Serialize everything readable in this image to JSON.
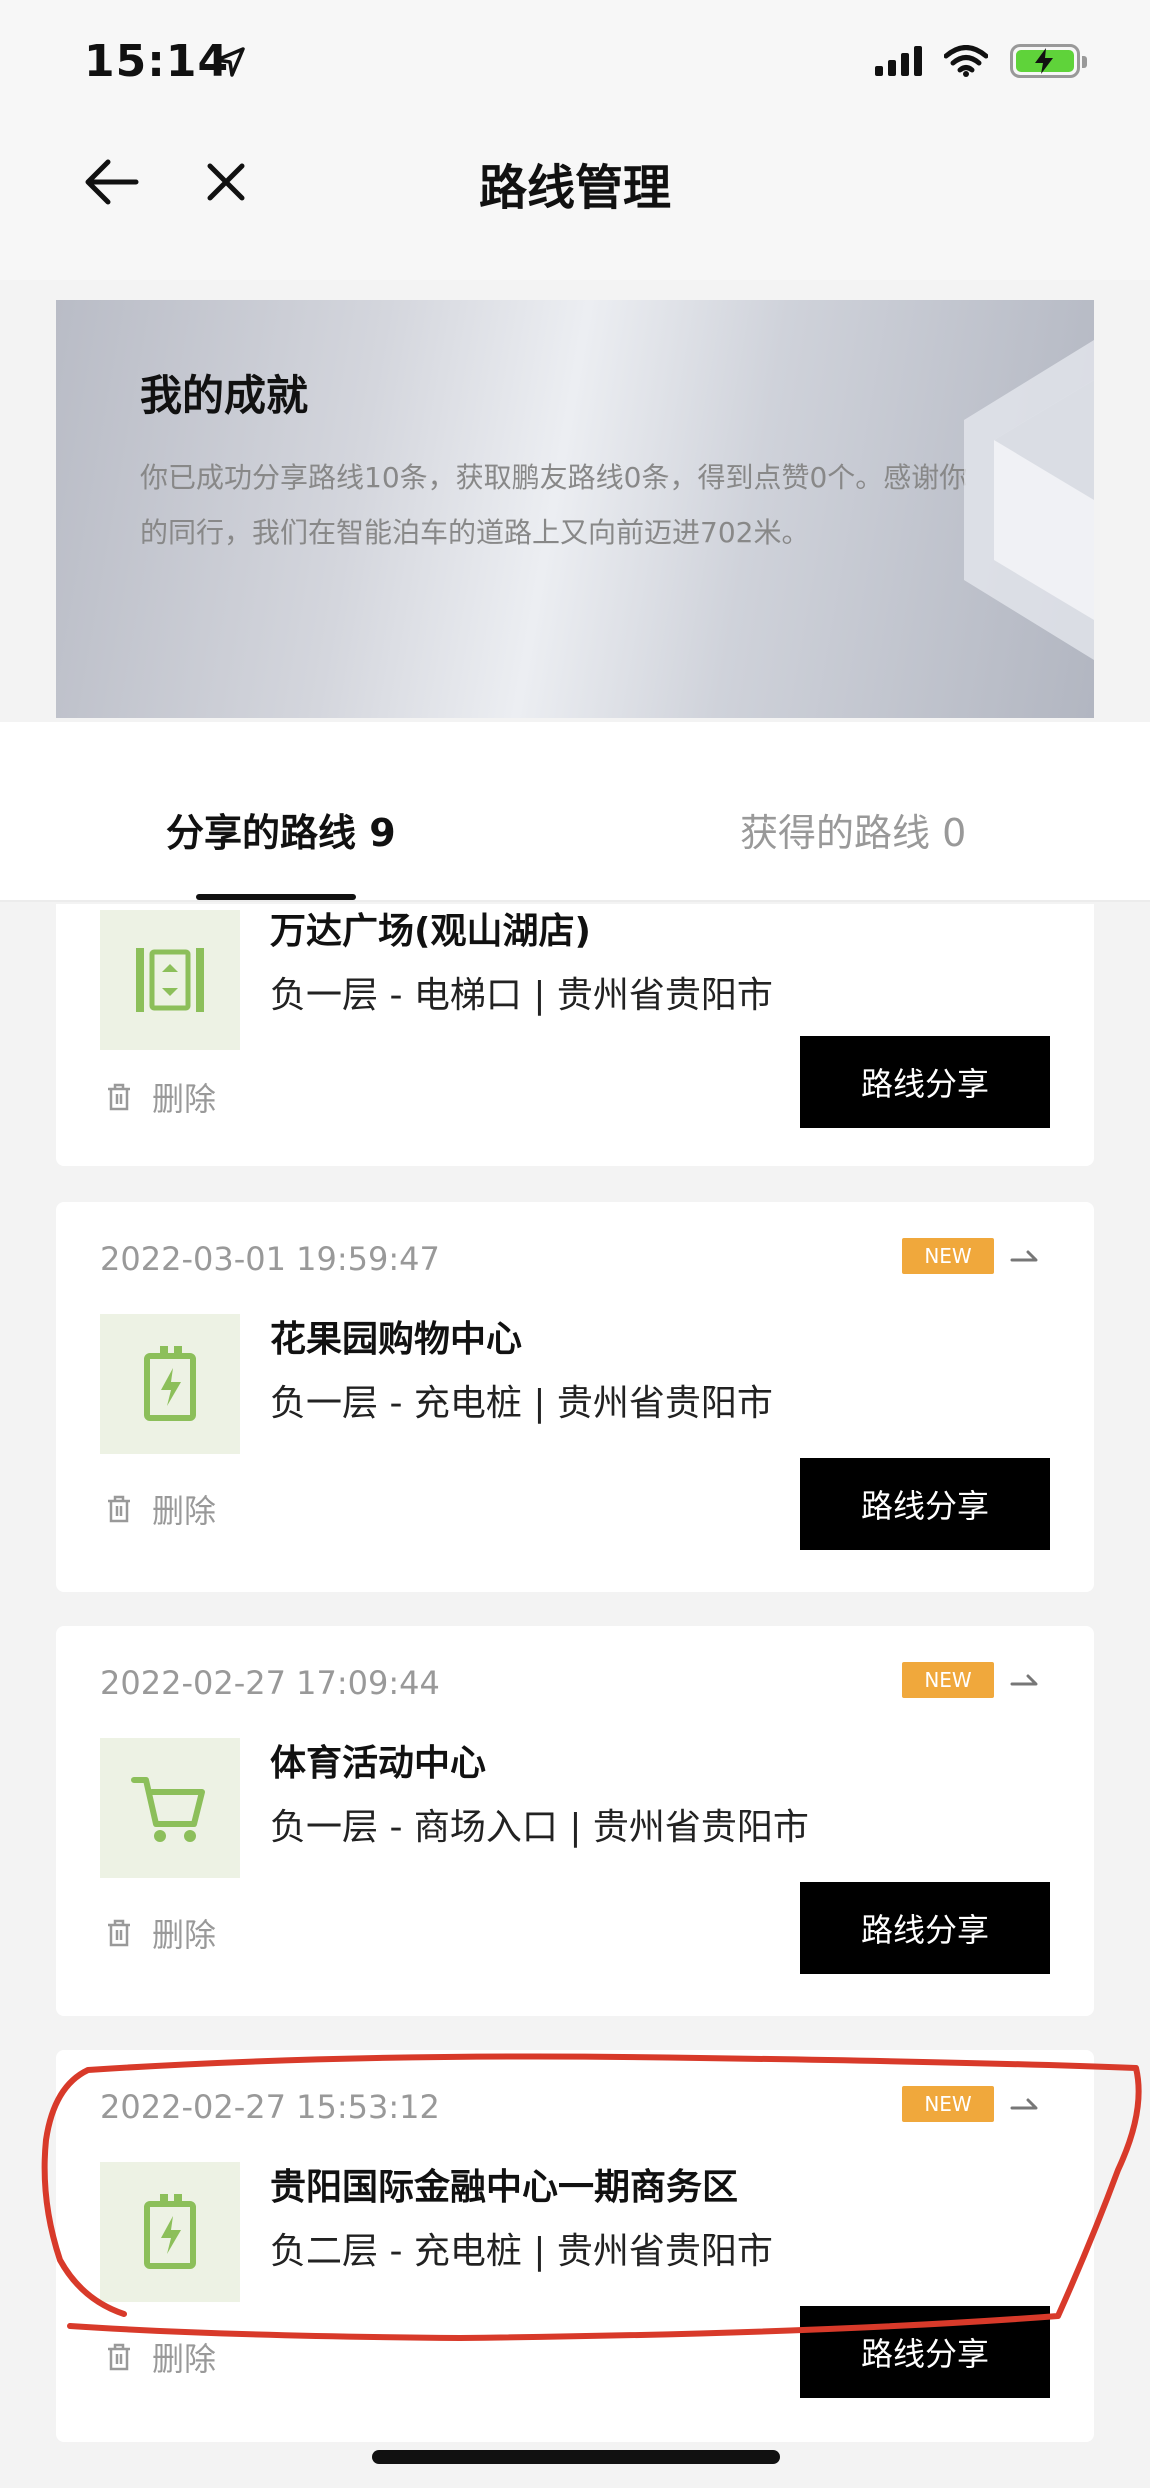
{
  "status_bar": {
    "time": "15:14"
  },
  "nav": {
    "title": "路线管理"
  },
  "achievement": {
    "title": "我的成就",
    "text": "你已成功分享路线10条，获取鹏友路线0条，得到点赞0个。感谢你的同行，我们在智能泊车的道路上又向前迈进702米。"
  },
  "tabs": [
    {
      "label": "分享的路线 9",
      "active": true
    },
    {
      "label": "获得的路线 0",
      "active": false
    }
  ],
  "common": {
    "delete_label": "删除",
    "share_label": "路线分享",
    "new_badge": "NEW"
  },
  "routes": [
    {
      "date": "",
      "name": "万达广场(观山湖店)",
      "detail": "负一层 - 电梯口 | 贵州省贵阳市",
      "icon": "elevator-icon",
      "is_new": false
    },
    {
      "date": "2022-03-01 19:59:47",
      "name": "花果园购物中心",
      "detail": "负一层 - 充电桩 | 贵州省贵阳市",
      "icon": "charging-pile-icon",
      "is_new": true
    },
    {
      "date": "2022-02-27 17:09:44",
      "name": "体育活动中心",
      "detail": "负一层 - 商场入口 | 贵州省贵阳市",
      "icon": "cart-icon",
      "is_new": true
    },
    {
      "date": "2022-02-27 15:53:12",
      "name": "贵阳国际金融中心一期商务区",
      "detail": "负二层 - 充电桩 | 贵州省贵阳市",
      "icon": "charging-pile-icon",
      "is_new": true
    }
  ],
  "colors": {
    "accent_green": "#8cbf5a",
    "badge_orange": "#f0a83c",
    "annotation_red": "#d83a2a"
  }
}
